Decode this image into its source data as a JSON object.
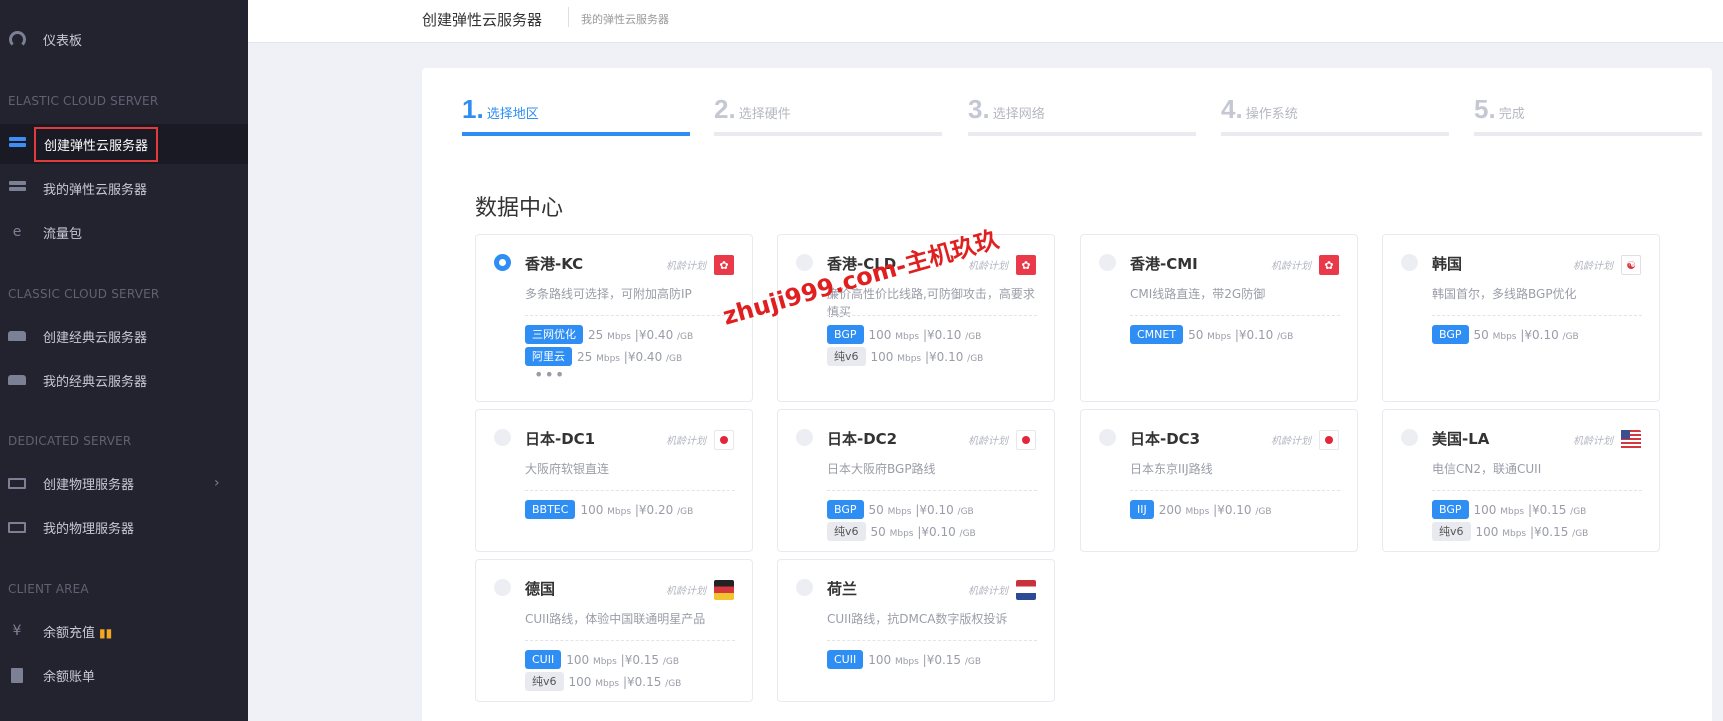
{
  "sidebar": {
    "dashboard": "仪表板",
    "section_elastic": "ELASTIC CLOUD SERVER",
    "create_elastic": "创建弹性云服务器",
    "my_elastic": "我的弹性云服务器",
    "traffic": "流量包",
    "section_classic": "CLASSIC CLOUD SERVER",
    "create_classic": "创建经典云服务器",
    "my_classic": "我的经典云服务器",
    "section_dedicated": "DEDICATED SERVER",
    "create_physical": "创建物理服务器",
    "my_physical": "我的物理服务器",
    "section_client": "CLIENT AREA",
    "recharge": "余额充值",
    "bill": "余额账单"
  },
  "header": {
    "title": "创建弹性云服务器",
    "breadcrumb": "我的弹性云服务器"
  },
  "steps": [
    {
      "num": "1.",
      "label": "选择地区",
      "active": true
    },
    {
      "num": "2.",
      "label": "选择硬件",
      "active": false
    },
    {
      "num": "3.",
      "label": "选择网络",
      "active": false
    },
    {
      "num": "4.",
      "label": "操作系统",
      "active": false
    },
    {
      "num": "5.",
      "label": "完成",
      "active": false
    }
  ],
  "section_title": "数据中心",
  "tag_text": "机龄计划",
  "more_text": "•••",
  "watermark": "zhuji999.com-主机玖玖",
  "datacenters": [
    {
      "name": "香港-KC",
      "selected": true,
      "flag": "hk",
      "flag_glyph": "✿",
      "desc": "多条路线可选择，可附加高防IP",
      "lines": [
        {
          "badge": "三网优化",
          "bw": "25",
          "unit": "Mbps",
          "price": "¥0.40",
          "per": "/GB"
        },
        {
          "badge": "阿里云",
          "bw": "25",
          "unit": "Mbps",
          "price": "¥0.40",
          "per": "/GB"
        }
      ]
    },
    {
      "name": "香港-CLD",
      "selected": false,
      "flag": "hk",
      "flag_glyph": "✿",
      "desc": "廉价高性价比线路,可防御攻击，高要求慎买",
      "lines": [
        {
          "badge": "BGP",
          "bw": "100",
          "unit": "Mbps",
          "price": "¥0.10",
          "per": "/GB"
        },
        {
          "badge": "纯v6",
          "gray": true,
          "bw": "100",
          "unit": "Mbps",
          "price": "¥0.10",
          "per": "/GB"
        }
      ]
    },
    {
      "name": "香港-CMI",
      "selected": false,
      "flag": "hk",
      "flag_glyph": "✿",
      "desc": "CMI线路直连，带2G防御",
      "lines": [
        {
          "badge": "CMNET",
          "bw": "50",
          "unit": "Mbps",
          "price": "¥0.10",
          "per": "/GB"
        }
      ]
    },
    {
      "name": "韩国",
      "selected": false,
      "flag": "kr",
      "flag_glyph": "☯",
      "desc": "韩国首尔，多线路BGP优化",
      "lines": [
        {
          "badge": "BGP",
          "bw": "50",
          "unit": "Mbps",
          "price": "¥0.10",
          "per": "/GB"
        }
      ]
    },
    {
      "name": "日本-DC1",
      "selected": false,
      "flag": "jp",
      "flag_glyph": "",
      "desc": "大阪府软银直连",
      "lines": [
        {
          "badge": "BBTEC",
          "bw": "100",
          "unit": "Mbps",
          "price": "¥0.20",
          "per": "/GB"
        }
      ]
    },
    {
      "name": "日本-DC2",
      "selected": false,
      "flag": "jp",
      "flag_glyph": "",
      "desc": "日本大阪府BGP路线",
      "lines": [
        {
          "badge": "BGP",
          "bw": "50",
          "unit": "Mbps",
          "price": "¥0.10",
          "per": "/GB"
        },
        {
          "badge": "纯v6",
          "gray": true,
          "bw": "50",
          "unit": "Mbps",
          "price": "¥0.10",
          "per": "/GB"
        }
      ]
    },
    {
      "name": "日本-DC3",
      "selected": false,
      "flag": "jp",
      "flag_glyph": "",
      "desc": "日本东京IIJ路线",
      "lines": [
        {
          "badge": "IIJ",
          "bw": "200",
          "unit": "Mbps",
          "price": "¥0.10",
          "per": "/GB"
        }
      ]
    },
    {
      "name": "美国-LA",
      "selected": false,
      "flag": "us",
      "flag_glyph": "",
      "desc": "电信CN2，联通CUII",
      "lines": [
        {
          "badge": "BGP",
          "bw": "100",
          "unit": "Mbps",
          "price": "¥0.15",
          "per": "/GB"
        },
        {
          "badge": "纯v6",
          "gray": true,
          "bw": "100",
          "unit": "Mbps",
          "price": "¥0.15",
          "per": "/GB"
        }
      ]
    },
    {
      "name": "德国",
      "selected": false,
      "flag": "de",
      "flag_glyph": "",
      "desc": "CUII路线，体验中国联通明星产品",
      "lines": [
        {
          "badge": "CUII",
          "bw": "100",
          "unit": "Mbps",
          "price": "¥0.15",
          "per": "/GB"
        },
        {
          "badge": "纯v6",
          "gray": true,
          "bw": "100",
          "unit": "Mbps",
          "price": "¥0.15",
          "per": "/GB"
        }
      ]
    },
    {
      "name": "荷兰",
      "selected": false,
      "flag": "nl",
      "flag_glyph": "",
      "desc": "CUII路线，抗DMCA数字版权投诉",
      "lines": [
        {
          "badge": "CUII",
          "bw": "100",
          "unit": "Mbps",
          "price": "¥0.15",
          "per": "/GB"
        }
      ]
    }
  ]
}
